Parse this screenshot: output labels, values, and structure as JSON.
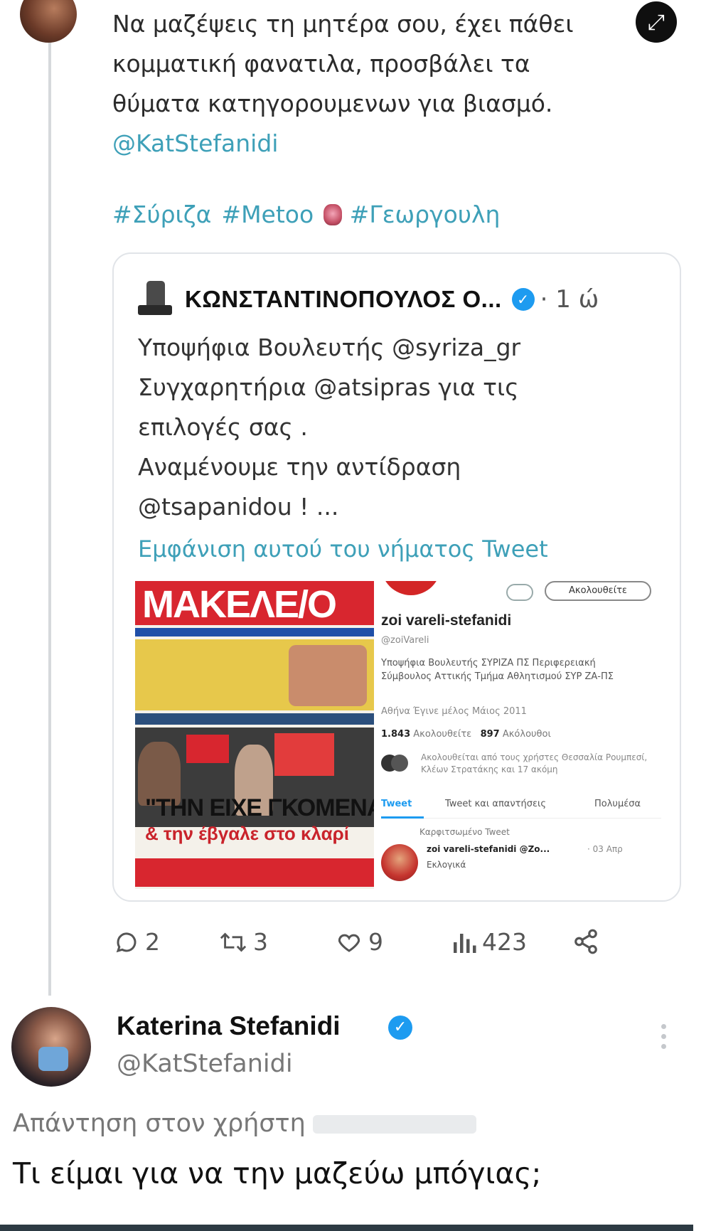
{
  "parent_tweet": {
    "lines": [
      "Να μαζέψεις τη μητέρα σου, έχει πάθει",
      "κομματική φανατιλα, προσβάλει τα",
      "θύματα κατηγορουμενων για βιασμό."
    ],
    "mention": "@KatStefanidi",
    "hashtags": [
      "#Σύριζα",
      "#Metoo",
      "#Γεωργουλη"
    ]
  },
  "quote": {
    "author": "ΚΩΝΣΤΑΝΤΙΝΟΠΟΥΛΟΣ Ο...",
    "time": "· 1 ώ",
    "lines": [
      "Υποψήφια Βουλευτής @syriza_gr",
      "Συγχαρητήρια  @atsipras  για τις",
      "επιλογές σας .",
      "Αναμένουμε την αντίδραση",
      "@tsapanidou ! ..."
    ],
    "show_thread": "Εμφάνιση αυτού του νήματος Tweet",
    "cover": {
      "title": "ΜΑΚΕΛΕ/Ο",
      "headline": "\"ΤΗΝ ΕΙΧΕ ΓΚΟΜΕΝΑ",
      "subheadline": "& την έβγαλε στο κλαρί"
    },
    "profile": {
      "follow": "Ακολουθείτε",
      "name": "zoi vareli-stefanidi",
      "handle": "@zoiVareli",
      "bio": "Υποψήφια Βουλευτής ΣΥΡΙΖΑ ΠΣ Περιφερειακή Σύμβουλος Αττικής Τμήμα Αθλητισμού ΣΥΡ ΖΑ-ΠΣ",
      "meta": "Αθήνα   Έγινε μέλος Μάιος 2011",
      "following": "1.843",
      "following_label": "Ακολουθείτε",
      "followers": "897",
      "followers_label": "Ακόλουθοι",
      "followed_by": "Ακολουθείται από τους χρήστες Θεσσαλία Ρουμπεσί, Κλέων Στρατάκης και 17 ακόμη",
      "tabs": [
        "Tweet",
        "Tweet και απαντήσεις",
        "Πολυμέσα"
      ],
      "pinned": "Καρφιτσωμένο Tweet",
      "tweet_name": "zoi vareli-stefanidi @Zo...",
      "tweet_date": "· 03 Απρ",
      "tweet_text": "Εκλογικά"
    }
  },
  "actions": {
    "replies": "2",
    "retweets": "3",
    "likes": "9",
    "views": "423"
  },
  "reply": {
    "name": "Katerina Stefanidi",
    "handle": "@KatStefanidi",
    "reply_to": "Απάντηση στον χρήστη",
    "text": "Τι είμαι για να την μαζεύω μπόγιας;"
  }
}
